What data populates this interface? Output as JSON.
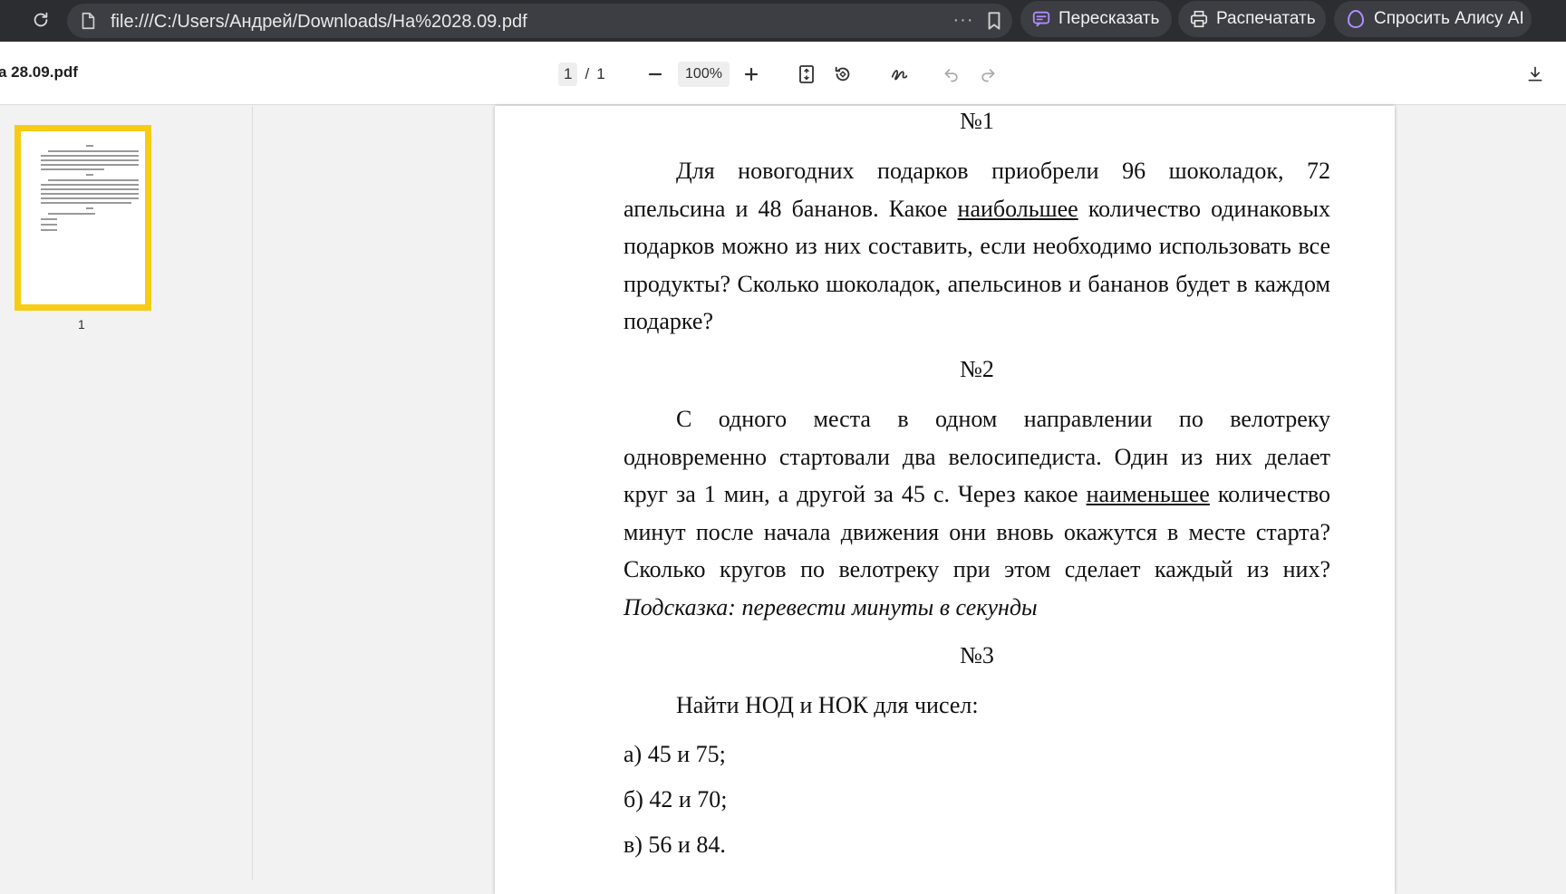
{
  "browser": {
    "url": "file:///C:/Users/Андрей/Downloads/На%2028.09.pdf",
    "more_label": "···",
    "actions": [
      {
        "label": "Пересказать",
        "icon": "retell-icon"
      },
      {
        "label": "Распечатать",
        "icon": "printer-icon"
      },
      {
        "label": "Спросить Алису AI",
        "icon": "alice-icon"
      }
    ]
  },
  "pdf_toolbar": {
    "file_name": "а 28.09.pdf",
    "page_current": "1",
    "page_sep": "/",
    "page_total": "1",
    "zoom": "100%"
  },
  "sidebar": {
    "thumb_page_number": "1"
  },
  "document": {
    "task1_title": "№1",
    "task1_part1": "Для новогодних подарков приобрели 96 шоколадок, 72 апельсина и 48 бананов. Какое ",
    "task1_underlined": "наибольшее",
    "task1_part2": " количество одинаковых подарков можно из них составить, если необходимо использовать все продукты? Сколько шоколадок, апельсинов и бананов будет в каждом подарке?",
    "task2_title": "№2",
    "task2_part1": "С одного места в одном направлении по велотреку одновременно стартовали два велосипедиста. Один из них делает круг за 1 мин, а другой за 45 с. Через какое ",
    "task2_underlined": "наименьшее",
    "task2_part2": " количество минут после начала движения они вновь окажутся в месте старта? Сколько кругов по велотреку при этом сделает каждый из них? ",
    "task2_hint": "Подсказка: перевести минуты в секунды",
    "task3_title": "№3",
    "task3_intro": "Найти НОД и НОК для чисел:",
    "task3_items": [
      "а) 45 и 75;",
      "б) 42 и 70;",
      "в) 56 и 84."
    ]
  },
  "colors": {
    "topbar_bg": "#2b2d31",
    "pill_bg": "#3c3e43",
    "thumb_border": "#f7cc14",
    "alice_accent": "#b18cff"
  }
}
